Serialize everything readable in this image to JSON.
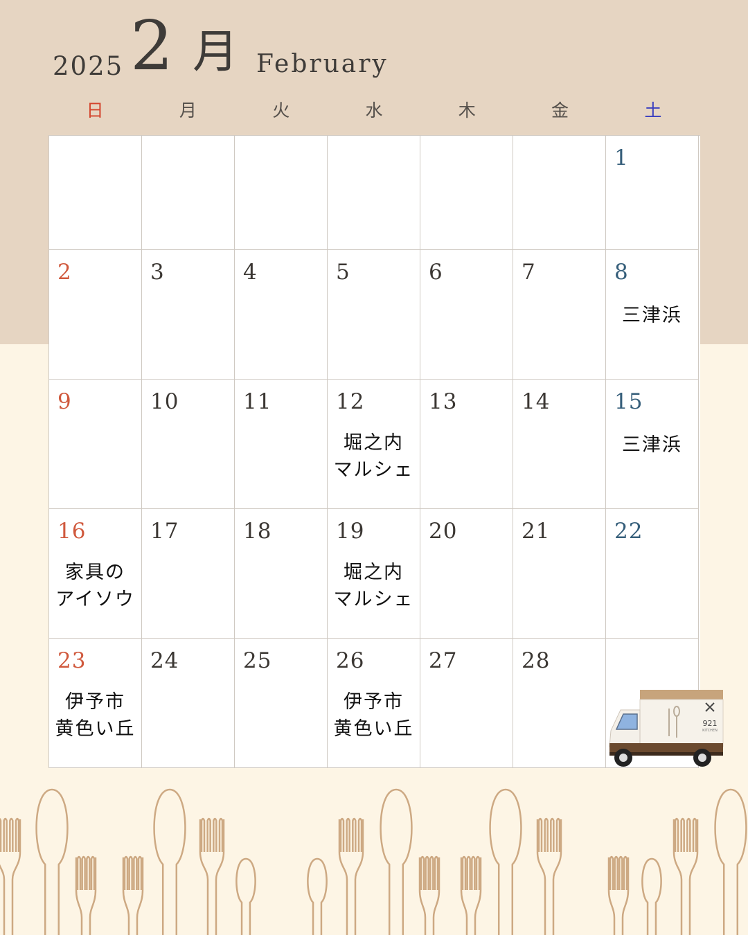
{
  "header": {
    "year": "2025",
    "month_number": "2",
    "month_kanji": "月",
    "month_english": "February"
  },
  "weekdays": [
    "日",
    "月",
    "火",
    "水",
    "木",
    "金",
    "土"
  ],
  "weeks": [
    [
      {
        "day": "",
        "event": []
      },
      {
        "day": "",
        "event": []
      },
      {
        "day": "",
        "event": []
      },
      {
        "day": "",
        "event": []
      },
      {
        "day": "",
        "event": []
      },
      {
        "day": "",
        "event": []
      },
      {
        "day": "1",
        "event": []
      }
    ],
    [
      {
        "day": "2",
        "event": []
      },
      {
        "day": "3",
        "event": []
      },
      {
        "day": "4",
        "event": []
      },
      {
        "day": "5",
        "event": []
      },
      {
        "day": "6",
        "event": []
      },
      {
        "day": "7",
        "event": []
      },
      {
        "day": "8",
        "event": [
          "三津浜"
        ]
      }
    ],
    [
      {
        "day": "9",
        "event": []
      },
      {
        "day": "10",
        "event": []
      },
      {
        "day": "11",
        "event": []
      },
      {
        "day": "12",
        "event": [
          "堀之内",
          "マルシェ"
        ]
      },
      {
        "day": "13",
        "event": []
      },
      {
        "day": "14",
        "event": []
      },
      {
        "day": "15",
        "event": [
          "三津浜"
        ]
      }
    ],
    [
      {
        "day": "16",
        "event": [
          "家具の",
          "アイソウ"
        ]
      },
      {
        "day": "17",
        "event": []
      },
      {
        "day": "18",
        "event": []
      },
      {
        "day": "19",
        "event": [
          "堀之内",
          "マルシェ"
        ]
      },
      {
        "day": "20",
        "event": []
      },
      {
        "day": "21",
        "event": []
      },
      {
        "day": "22",
        "event": []
      }
    ],
    [
      {
        "day": "23",
        "event": [
          "伊予市",
          "黄色い丘"
        ]
      },
      {
        "day": "24",
        "event": []
      },
      {
        "day": "25",
        "event": []
      },
      {
        "day": "26",
        "event": [
          "伊予市",
          "黄色い丘"
        ]
      },
      {
        "day": "27",
        "event": []
      },
      {
        "day": "28",
        "event": []
      },
      {
        "day": "",
        "event": []
      }
    ]
  ],
  "truck": {
    "logo_text": "921",
    "logo_subtext": "KITCHEN"
  },
  "colors": {
    "top_band": "#e6d5c2",
    "background": "#fdf5e5",
    "sunday": "#d0593d",
    "saturday": "#355e7a",
    "cutlery": "#cda983"
  }
}
